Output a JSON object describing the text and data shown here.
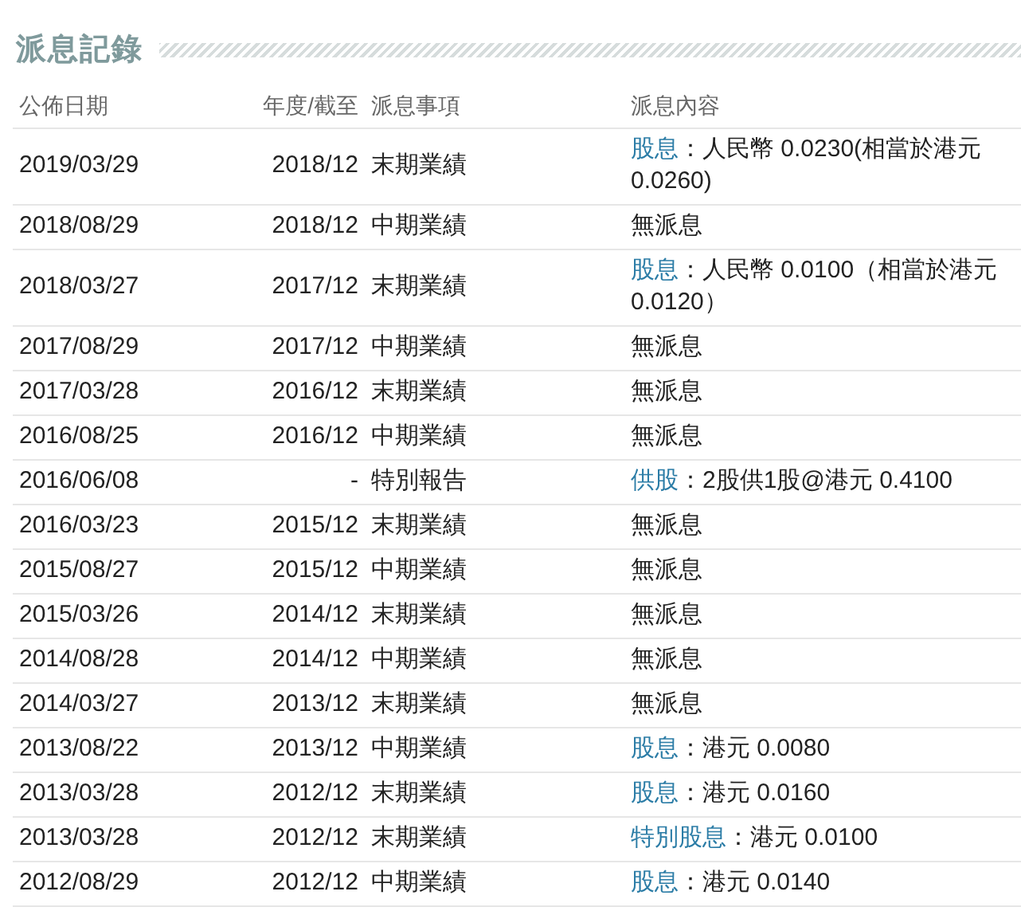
{
  "title": "派息記錄",
  "columns": [
    "公佈日期",
    "年度/截至",
    "派息事項",
    "派息內容"
  ],
  "rows": [
    {
      "date": "2019/03/29",
      "period": "2018/12",
      "event": "末期業績",
      "tag": "股息",
      "text": "：人民幣 0.0230(相當於港元 0.0260)"
    },
    {
      "date": "2018/08/29",
      "period": "2018/12",
      "event": "中期業績",
      "text": "無派息"
    },
    {
      "date": "2018/03/27",
      "period": "2017/12",
      "event": "末期業績",
      "tag": "股息",
      "text": "：人民幣 0.0100（相當於港元 0.0120）"
    },
    {
      "date": "2017/08/29",
      "period": "2017/12",
      "event": "中期業績",
      "text": "無派息"
    },
    {
      "date": "2017/03/28",
      "period": "2016/12",
      "event": "末期業績",
      "text": "無派息"
    },
    {
      "date": "2016/08/25",
      "period": "2016/12",
      "event": "中期業績",
      "text": "無派息"
    },
    {
      "date": "2016/06/08",
      "period": "-",
      "event": "特別報告",
      "tag": "供股",
      "text": "：2股供1股@港元 0.4100"
    },
    {
      "date": "2016/03/23",
      "period": "2015/12",
      "event": "末期業績",
      "text": "無派息"
    },
    {
      "date": "2015/08/27",
      "period": "2015/12",
      "event": "中期業績",
      "text": "無派息"
    },
    {
      "date": "2015/03/26",
      "period": "2014/12",
      "event": "末期業績",
      "text": "無派息"
    },
    {
      "date": "2014/08/28",
      "period": "2014/12",
      "event": "中期業績",
      "text": "無派息"
    },
    {
      "date": "2014/03/27",
      "period": "2013/12",
      "event": "末期業績",
      "text": "無派息"
    },
    {
      "date": "2013/08/22",
      "period": "2013/12",
      "event": "中期業績",
      "tag": "股息",
      "text": "：港元 0.0080"
    },
    {
      "date": "2013/03/28",
      "period": "2012/12",
      "event": "末期業績",
      "tag": "股息",
      "text": "：港元 0.0160"
    },
    {
      "date": "2013/03/28",
      "period": "2012/12",
      "event": "末期業績",
      "tag": "特別股息",
      "text": "：港元 0.0100"
    },
    {
      "date": "2012/08/29",
      "period": "2012/12",
      "event": "中期業績",
      "tag": "股息",
      "text": "：港元 0.0140"
    }
  ]
}
